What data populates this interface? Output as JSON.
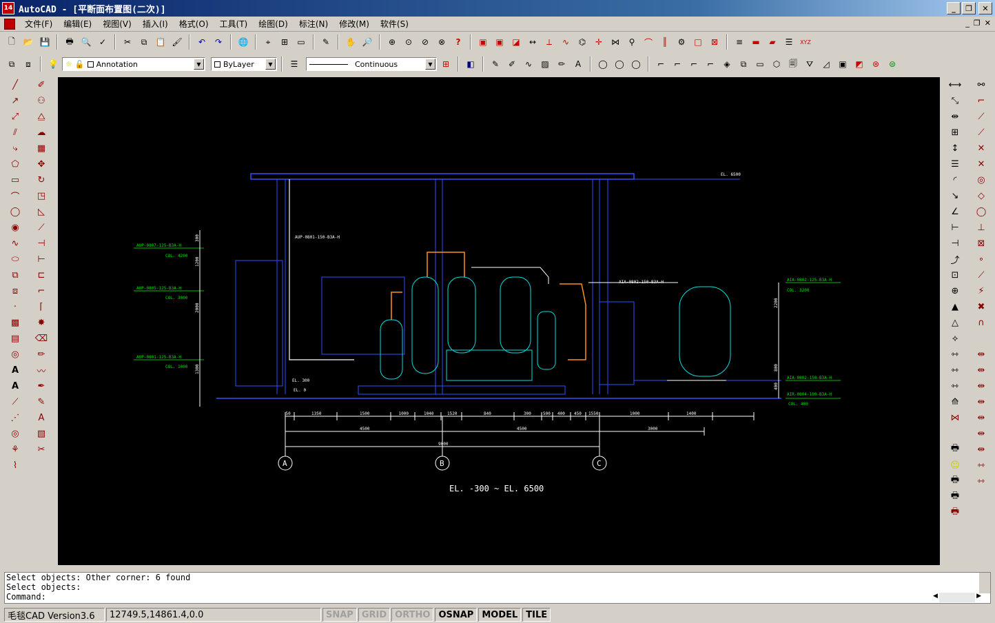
{
  "window": {
    "title": "AutoCAD  - [平断面布置图(二次)]",
    "icon_label": "14"
  },
  "menu": [
    "文件(F)",
    "编辑(E)",
    "视图(V)",
    "插入(I)",
    "格式(O)",
    "工具(T)",
    "绘图(D)",
    "标注(N)",
    "修改(M)",
    "软件(S)"
  ],
  "properties": {
    "layer": "Annotation",
    "color": "ByLayer",
    "linetype": "Continuous"
  },
  "drawing": {
    "elevation_label": "EL. -300 ~ EL. 6500",
    "el_top": "EL. 6500",
    "el_300": "EL. 300",
    "el_0": "EL. 0",
    "el_500": "EL. 500",
    "grid_a": "A",
    "grid_b": "B",
    "grid_c": "C",
    "dims_row1": [
      "50",
      "1350",
      "1500",
      "1000",
      "1040",
      "1520",
      "840",
      "300",
      "500",
      "400",
      "450",
      "1550",
      "1000",
      "1400"
    ],
    "dims_row2": [
      "4500",
      "4500",
      "3000"
    ],
    "dim_total": "9000",
    "left_labels": [
      {
        "line": "AUP-0807-125-B3A-H",
        "sub": "COL. 4200"
      },
      {
        "line": "AUP-0805-125-B3A-H",
        "sub": "COL. 3000"
      },
      {
        "line": "AUP-0801-125-B3A-H",
        "sub": "COL. 1000"
      }
    ],
    "right_labels": [
      {
        "line": "AIA-0802-125-B3A-H",
        "sub": "COL. 3200"
      },
      {
        "line": "AIA-0802-150-B3A-H",
        "sub": ""
      },
      {
        "line": "AIR-0804-100-B3A-H",
        "sub": "COL. 400"
      }
    ],
    "top_pipe_label": "AUP-0801-150-B3A-H",
    "mid_pipe_label": "AIA-0802-150-B3A-H",
    "vert_dims": [
      "300",
      "1200",
      "2000",
      "1300",
      "2200",
      "800",
      "400"
    ]
  },
  "command": {
    "lines": [
      "Select objects: Other corner: 6 found",
      "Select objects:",
      "Command:"
    ]
  },
  "status": {
    "app_version": "毛毯CAD Version3.6",
    "coords": "12749.5,14861.4,0.0",
    "toggles": [
      {
        "label": "SNAP",
        "on": false
      },
      {
        "label": "GRID",
        "on": false
      },
      {
        "label": "ORTHO",
        "on": false
      },
      {
        "label": "OSNAP",
        "on": true
      },
      {
        "label": "MODEL",
        "on": true
      },
      {
        "label": "TILE",
        "on": true
      }
    ]
  }
}
